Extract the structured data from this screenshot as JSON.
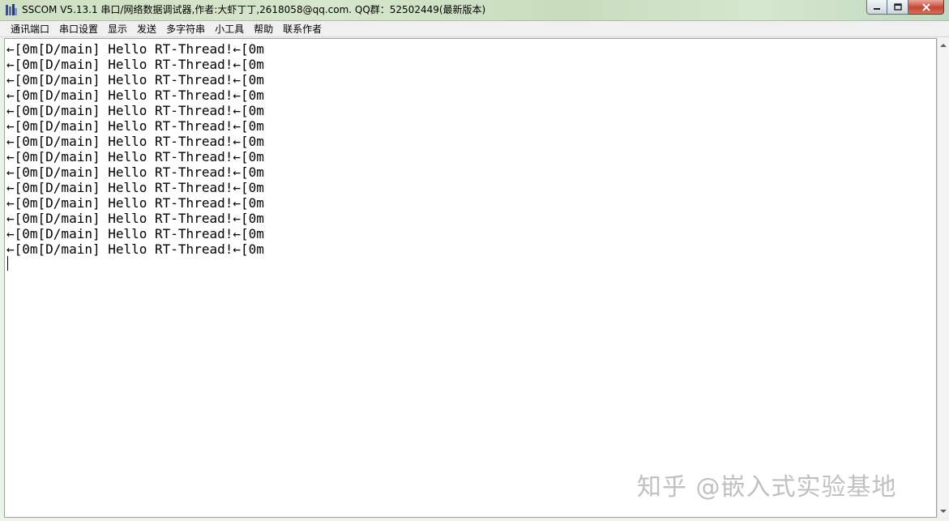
{
  "window": {
    "title": "SSCOM V5.13.1 串口/网络数据调试器,作者:大虾丁丁,2618058@qq.com. QQ群：52502449(最新版本)",
    "icon": "sscom-app-icon",
    "controls": [
      "minimize-icon",
      "maximize-icon",
      "close-icon"
    ]
  },
  "menubar": {
    "items": [
      {
        "label": "通讯端口"
      },
      {
        "label": "串口设置"
      },
      {
        "label": "显示"
      },
      {
        "label": "发送"
      },
      {
        "label": "多字符串"
      },
      {
        "label": "小工具"
      },
      {
        "label": "帮助"
      },
      {
        "label": "联系作者"
      }
    ]
  },
  "receive_area": {
    "lines": [
      "←[0m[D/main] Hello RT-Thread!←[0m",
      "←[0m[D/main] Hello RT-Thread!←[0m",
      "←[0m[D/main] Hello RT-Thread!←[0m",
      "←[0m[D/main] Hello RT-Thread!←[0m",
      "←[0m[D/main] Hello RT-Thread!←[0m",
      "←[0m[D/main] Hello RT-Thread!←[0m",
      "←[0m[D/main] Hello RT-Thread!←[0m",
      "←[0m[D/main] Hello RT-Thread!←[0m",
      "←[0m[D/main] Hello RT-Thread!←[0m",
      "←[0m[D/main] Hello RT-Thread!←[0m",
      "←[0m[D/main] Hello RT-Thread!←[0m",
      "←[0m[D/main] Hello RT-Thread!←[0m",
      "←[0m[D/main] Hello RT-Thread!←[0m",
      "←[0m[D/main] Hello RT-Thread!←[0m"
    ]
  },
  "watermark": {
    "text": "知乎 @嵌入式实验基地"
  }
}
